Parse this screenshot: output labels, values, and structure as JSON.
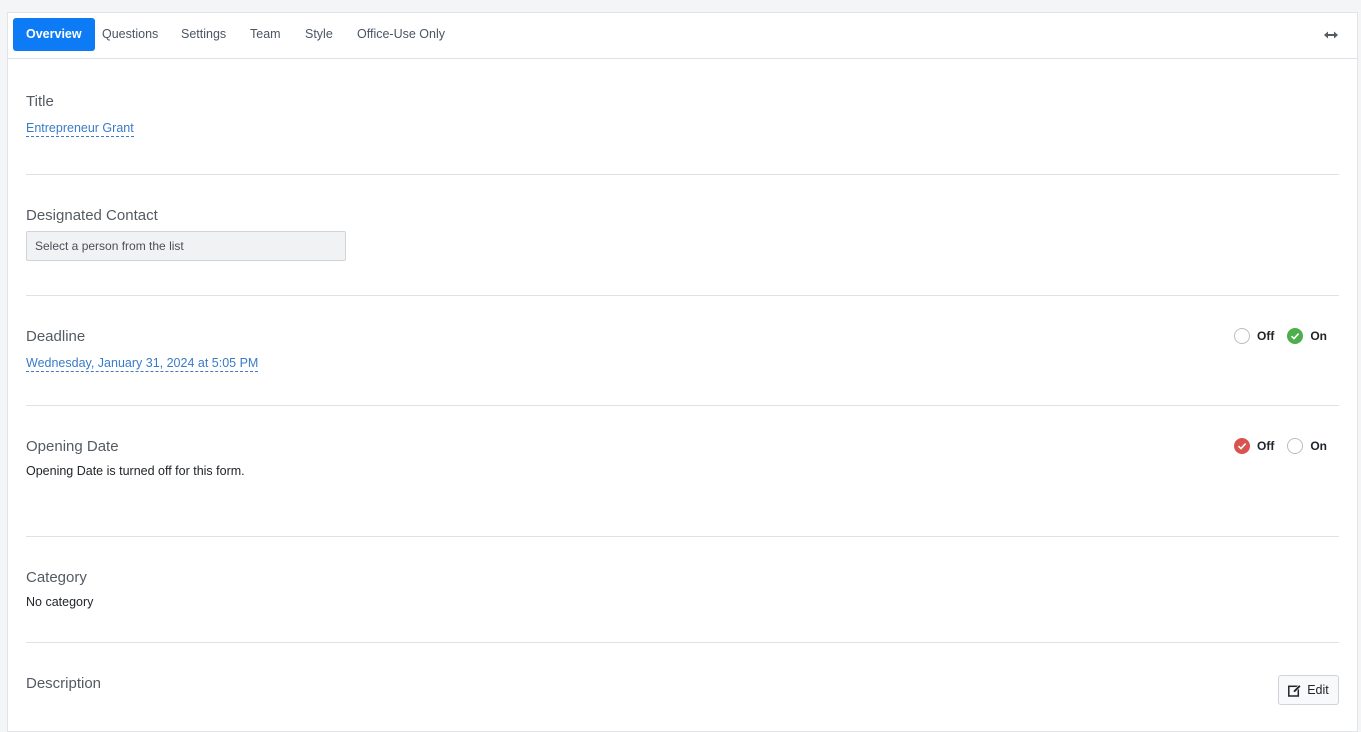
{
  "tabs": [
    {
      "label": "Overview",
      "active": true
    },
    {
      "label": "Questions"
    },
    {
      "label": "Settings"
    },
    {
      "label": "Team"
    },
    {
      "label": "Style"
    },
    {
      "label": "Office-Use Only"
    }
  ],
  "icons": {
    "expand": "horizontal-expand-icon",
    "check": "check-icon",
    "edit": "edit-icon"
  },
  "colors": {
    "accent": "#0d7bf5",
    "on_green": "#4cae4c",
    "off_red": "#d9534f",
    "link": "#3a7bc8"
  },
  "title_section": {
    "label": "Title",
    "value": "Entrepreneur Grant"
  },
  "contact_section": {
    "label": "Designated Contact",
    "placeholder": "Select a person from the list"
  },
  "deadline_section": {
    "label": "Deadline",
    "value": "Wednesday, January 31, 2024 at 5:05 PM",
    "off_label": "Off",
    "on_label": "On",
    "selected": "On"
  },
  "opening_section": {
    "label": "Opening Date",
    "value": "Opening Date is turned off for this form.",
    "off_label": "Off",
    "on_label": "On",
    "selected": "Off"
  },
  "category_section": {
    "label": "Category",
    "value": "No category"
  },
  "description_section": {
    "label": "Description",
    "edit_label": "Edit"
  }
}
